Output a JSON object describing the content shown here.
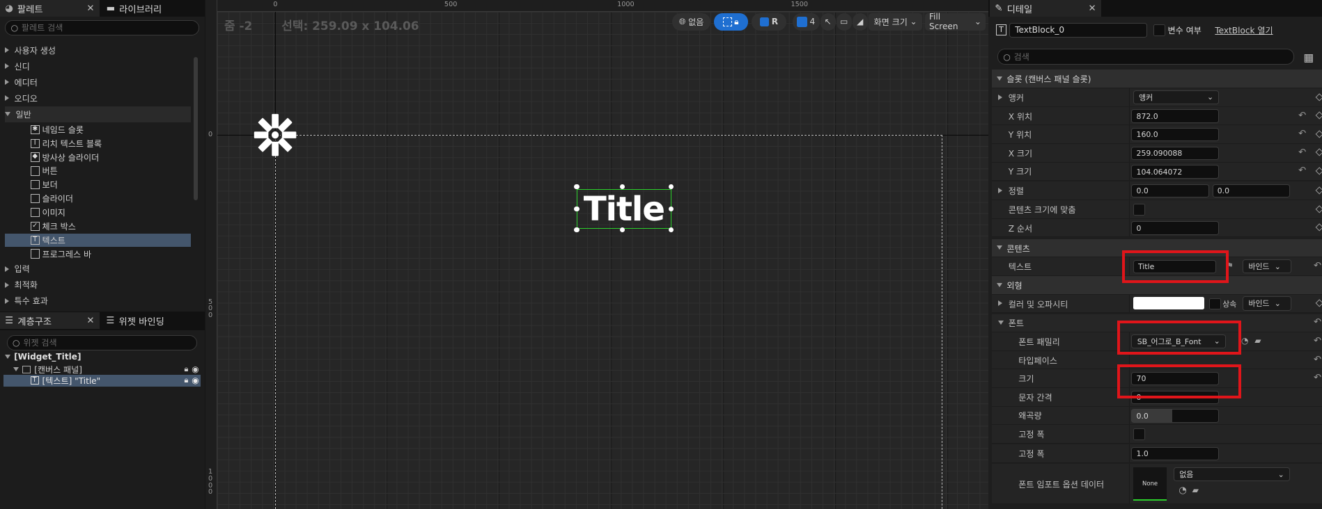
{
  "palette": {
    "tab": "팔레트",
    "library_tab": "라이브러리",
    "search_placeholder": "팔레트 검색",
    "categories": [
      "사용자 생성",
      "신디",
      "에디터",
      "오디오",
      "일반",
      "입력",
      "최적화",
      "특수 효과"
    ],
    "widgets": [
      {
        "label": "네임드 슬롯",
        "icon": "named-slot-icon",
        "glyph": "✱"
      },
      {
        "label": "리치 텍스트 블록",
        "icon": "rich-text-icon",
        "glyph": "I"
      },
      {
        "label": "방사상 슬라이더",
        "icon": "radial-slider-icon",
        "glyph": "◆"
      },
      {
        "label": "버튼",
        "icon": "button-icon",
        "glyph": ""
      },
      {
        "label": "보더",
        "icon": "border-icon",
        "glyph": ""
      },
      {
        "label": "슬라이더",
        "icon": "slider-icon",
        "glyph": ""
      },
      {
        "label": "이미지",
        "icon": "image-icon",
        "glyph": ""
      },
      {
        "label": "체크 박스",
        "icon": "checkbox-icon",
        "glyph": "✓"
      },
      {
        "label": "텍스트",
        "icon": "text-icon",
        "glyph": "T"
      },
      {
        "label": "프로그레스 바",
        "icon": "progress-bar-icon",
        "glyph": ""
      }
    ]
  },
  "hierarchy": {
    "tab": "계층구조",
    "binding_tab": "위젯 바인딩",
    "search_placeholder": "위젯 검색",
    "root": "[Widget_Title]",
    "canvas": "[캔버스 패널]",
    "text_item": "[텍스트] \"Title\""
  },
  "viewport": {
    "zoom": "줌 -2",
    "selection": "선택: 259.09 x 104.06",
    "ruler_top": [
      "0",
      "500",
      "1000",
      "1500"
    ],
    "ruler_left": [
      "0",
      "500",
      "1000"
    ],
    "toolbar": {
      "none": "없음",
      "r": "R",
      "grid": "4",
      "screen_size": "화면 크기",
      "fill_screen": "Fill Screen"
    },
    "widget_text": "Title"
  },
  "details": {
    "tab": "디테일",
    "name": "TextBlock_0",
    "is_variable": "변수 여부",
    "open_link": "TextBlock 열기",
    "search_placeholder": "검색",
    "slot_section": "슬롯 (캔버스 패널 슬롯)",
    "anchor_label": "앵커",
    "anchor_value": "앵커",
    "x_pos_label": "X 위치",
    "x_pos": "872.0",
    "y_pos_label": "Y 위치",
    "y_pos": "160.0",
    "x_size_label": "X 크기",
    "x_size": "259.090088",
    "y_size_label": "Y 크기",
    "y_size": "104.064072",
    "align_label": "정렬",
    "align_x": "0.0",
    "align_y": "0.0",
    "autosize_label": "콘텐츠 크기에 맞춤",
    "zorder_label": "Z 순서",
    "zorder": "0",
    "content_section": "콘텐츠",
    "text_label": "텍스트",
    "text_value": "Title",
    "bind": "바인드",
    "appearance_section": "외형",
    "color_label": "컬러 및 오파시티",
    "inherit": "상속",
    "font_section": "폰트",
    "font_family_label": "폰트 패밀리",
    "font_family": "SB_어그로_B_Font",
    "typeface_label": "타입페이스",
    "size_label": "크기",
    "size": "70",
    "letter_spacing_label": "문자 간격",
    "letter_spacing": "0",
    "skew_label": "왜곡량",
    "skew": "0.0",
    "fixed_width_label": "고정 폭",
    "fixed_width2_label": "고정 폭",
    "fixed_width_value": "1.0",
    "import_label": "폰트 임포트 옵션 데이터",
    "import_preview": "None",
    "import_value": "없음"
  }
}
